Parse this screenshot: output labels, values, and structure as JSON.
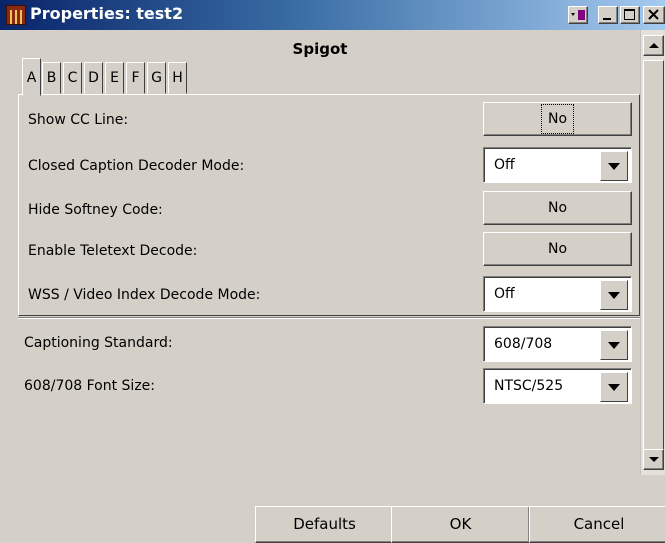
{
  "window": {
    "title": "Properties: test2"
  },
  "header": {
    "title": "Spigot"
  },
  "tabs": [
    "A",
    "B",
    "C",
    "D",
    "E",
    "F",
    "G",
    "H"
  ],
  "panel": {
    "show_cc_line": {
      "label": "Show CC Line:",
      "value": "No"
    },
    "cc_decoder_mode": {
      "label": "Closed Caption Decoder Mode:",
      "value": "Off"
    },
    "hide_softney": {
      "label": "Hide Softney Code:",
      "value": "No"
    },
    "teletext": {
      "label": "Enable Teletext Decode:",
      "value": "No"
    },
    "wss_mode": {
      "label": "WSS / Video Index Decode Mode:",
      "value": "Off"
    }
  },
  "options": {
    "captioning_standard": {
      "label": "Captioning Standard:",
      "value": "608/708"
    },
    "font_size": {
      "label": "608/708 Font Size:",
      "value": "NTSC/525"
    }
  },
  "footer": {
    "defaults": "Defaults",
    "ok": "OK",
    "cancel": "Cancel"
  },
  "colors": {
    "face": "#d4d0c8",
    "title_start": "#0a246a",
    "title_end": "#a6caf0"
  }
}
